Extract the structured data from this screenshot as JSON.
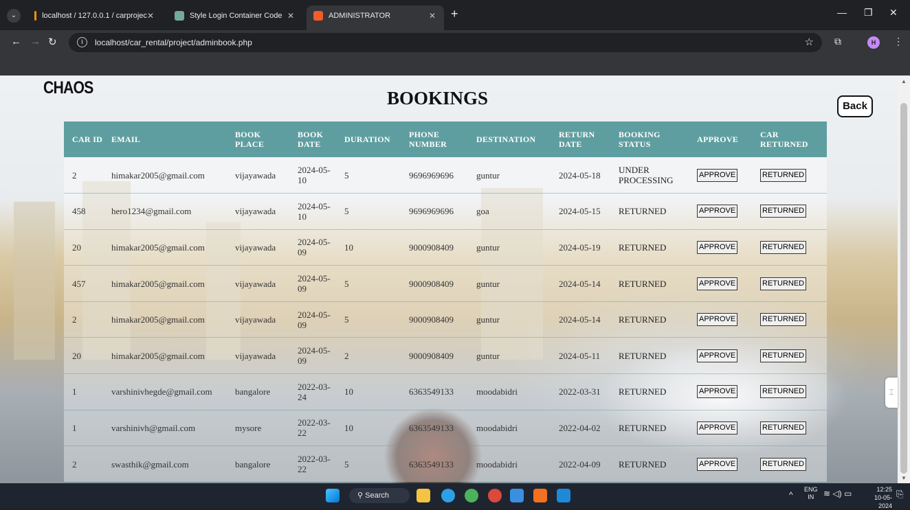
{
  "browser": {
    "tabs": [
      {
        "title": "localhost / 127.0.0.1 / carprojec",
        "active": false
      },
      {
        "title": "Style Login Container Code",
        "active": false
      },
      {
        "title": "ADMINISTRATOR",
        "active": true
      }
    ],
    "url": "localhost/car_rental/project/adminbook.php",
    "profile_initial": "H"
  },
  "page": {
    "brand": "CHAOS",
    "title": "BOOKINGS",
    "back_label": "Back"
  },
  "table": {
    "headers": [
      "CAR ID",
      "EMAIL",
      "BOOK PLACE",
      "BOOK DATE",
      "DURATION",
      "PHONE NUMBER",
      "DESTINATION",
      "RETURN DATE",
      "BOOKING STATUS",
      "APPROVE",
      "CAR RETURNED"
    ],
    "approve_label": "APPROVE",
    "returned_label": "RETURNED",
    "rows": [
      {
        "car_id": "2",
        "email": "himakar2005@gmail.com",
        "place": "vijayawada",
        "book_date": "2024-05-10",
        "duration": "5",
        "phone": "9696969696",
        "destination": "guntur",
        "return_date": "2024-05-18",
        "status": "UNDER PROCESSING"
      },
      {
        "car_id": "458",
        "email": "hero1234@gmail.com",
        "place": "vijayawada",
        "book_date": "2024-05-10",
        "duration": "5",
        "phone": "9696969696",
        "destination": "goa",
        "return_date": "2024-05-15",
        "status": "RETURNED"
      },
      {
        "car_id": "20",
        "email": "himakar2005@gmail.com",
        "place": "vijayawada",
        "book_date": "2024-05-09",
        "duration": "10",
        "phone": "9000908409",
        "destination": "guntur",
        "return_date": "2024-05-19",
        "status": "RETURNED"
      },
      {
        "car_id": "457",
        "email": "himakar2005@gmail.com",
        "place": "vijayawada",
        "book_date": "2024-05-09",
        "duration": "5",
        "phone": "9000908409",
        "destination": "guntur",
        "return_date": "2024-05-14",
        "status": "RETURNED"
      },
      {
        "car_id": "2",
        "email": "himakar2005@gmail.com",
        "place": "vijayawada",
        "book_date": "2024-05-09",
        "duration": "5",
        "phone": "9000908409",
        "destination": "guntur",
        "return_date": "2024-05-14",
        "status": "RETURNED"
      },
      {
        "car_id": "20",
        "email": "himakar2005@gmail.com",
        "place": "vijayawada",
        "book_date": "2024-05-09",
        "duration": "2",
        "phone": "9000908409",
        "destination": "guntur",
        "return_date": "2024-05-11",
        "status": "RETURNED"
      },
      {
        "car_id": "1",
        "email": "varshinivhegde@gmail.com",
        "place": "bangalore",
        "book_date": "2022-03-24",
        "duration": "10",
        "phone": "6363549133",
        "destination": "moodabidri",
        "return_date": "2022-03-31",
        "status": "RETURNED"
      },
      {
        "car_id": "1",
        "email": "varshinivh@gmail.com",
        "place": "mysore",
        "book_date": "2022-03-22",
        "duration": "10",
        "phone": "6363549133",
        "destination": "moodabidri",
        "return_date": "2022-04-02",
        "status": "RETURNED"
      },
      {
        "car_id": "2",
        "email": "swasthik@gmail.com",
        "place": "bangalore",
        "book_date": "2022-03-22",
        "duration": "5",
        "phone": "6363549133",
        "destination": "moodabidri",
        "return_date": "2022-04-09",
        "status": "RETURNED"
      }
    ]
  },
  "taskbar": {
    "search_label": "Search",
    "lang_line1": "ENG",
    "lang_line2": "IN",
    "time": "12:25",
    "date": "10-05-2024"
  },
  "colors": {
    "header_bg": "#5f9ea0",
    "browser_bg": "#202124",
    "toolbar_bg": "#35363a"
  }
}
